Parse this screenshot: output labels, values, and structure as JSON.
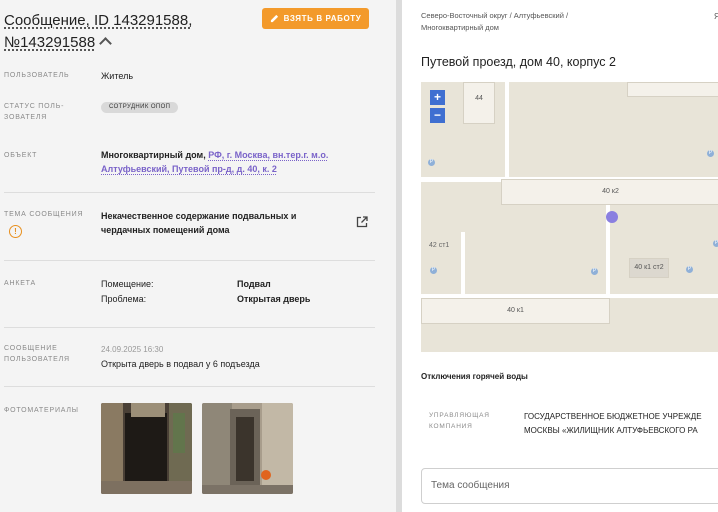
{
  "left": {
    "title": "Сообщение, ID 143291588, №143291588",
    "take_button": "ВЗЯТЬ В РАБОТУ",
    "user_label": "ПОЛЬЗОВАТЕЛЬ",
    "user_value": "Житель",
    "status_label_1": "СТАТУС ПОЛЬ-",
    "status_label_2": "ЗОВАТЕЛЯ",
    "status_badge": "СОТРУДНИК ОПОП",
    "object_label": "ОБЪЕКТ",
    "object_prefix": "Многоквартирный дом,",
    "object_link_1": "РФ, г. Москва, вн.тер.г. м.о.",
    "object_link_2": "Алтуфьевский, Путевой пр-д, д. 40, к. 2",
    "topic_label": "ТЕМА СООБЩЕНИЯ",
    "topic_line_1": "Некачественное содержание подвальных и",
    "topic_line_2": "чердачных помещений дома",
    "survey_label": "АНКЕТА",
    "survey": [
      {
        "key": "Помещение:",
        "value": "Подвал"
      },
      {
        "key": "Проблема:",
        "value": "Открытая дверь"
      }
    ],
    "message_label_1": "СООБЩЕНИЕ",
    "message_label_2": "ПОЛЬЗОВАТЕЛЯ",
    "message_date": "24.09.2025 16:30",
    "message_text": "Открыта дверь в подвал у 6 подъезда",
    "photos_label": "ФОТОМАТЕРИАЛЫ"
  },
  "right": {
    "breadcrumb_1": "Северо-Восточный округ / Алтуфьевский /",
    "breadcrumb_2": "Многоквартирный дом",
    "corner_letter": "Я",
    "address": "Путевой проезд, дом 40, корпус 2",
    "map": {
      "zoom_in": "+",
      "zoom_out": "−",
      "labels": [
        "44",
        "40 к2",
        "42 ст1",
        "40 к1 ст2",
        "40 к1"
      ]
    },
    "hot_water": "Отключения горячей воды",
    "mc_label_1": "УПРАВЛЯЮЩАЯ",
    "mc_label_2": "КОМПАНИЯ",
    "mc_line_1": "ГОСУДАРСТВЕННОЕ БЮДЖЕТНОЕ УЧРЕЖДЕ",
    "mc_line_2": "МОСКВЫ «ЖИЛИЩНИК АЛТУФЬЕВСКОГО РА",
    "topic_placeholder": "Тема сообщения"
  },
  "colors": {
    "accent": "#f39a2b",
    "link": "#7a63c9",
    "map_marker": "#8a7fe0",
    "zoom": "#3f6fd1"
  }
}
